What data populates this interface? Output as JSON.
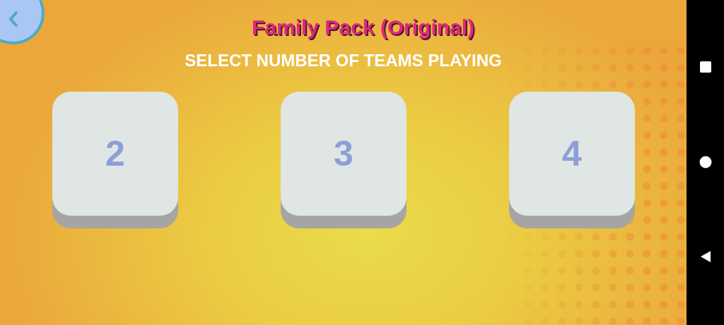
{
  "header": {
    "title": "Family Pack (Original)",
    "subtitle": "SELECT NUMBER OF TEAMS PLAYING"
  },
  "team_options": [
    {
      "label": "2"
    },
    {
      "label": "3"
    },
    {
      "label": "4"
    }
  ]
}
